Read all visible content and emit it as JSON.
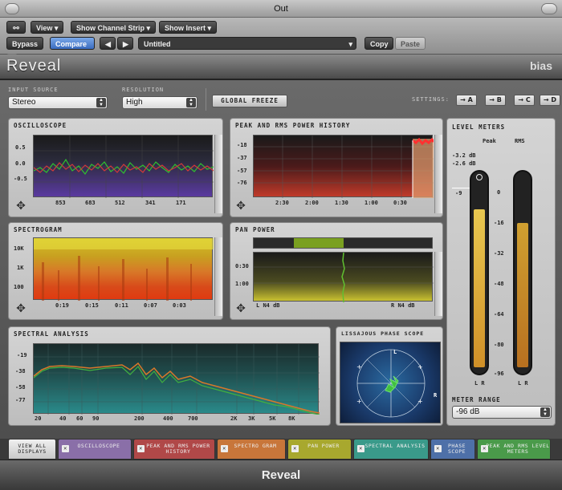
{
  "window": {
    "title": "Out"
  },
  "toolbar": {
    "view_label": "View",
    "show_channel_strip_label": "Show Channel Strip",
    "show_insert_label": "Show Insert",
    "bypass_label": "Bypass",
    "compare_label": "Compare",
    "preset_name": "Untitled",
    "copy_label": "Copy",
    "paste_label": "Paste"
  },
  "brand": {
    "name": "Reveal",
    "logo": "bias"
  },
  "controls": {
    "input_source_label": "Input Source",
    "input_source_value": "Stereo",
    "resolution_label": "Resolution",
    "resolution_value": "High",
    "global_freeze_label": "Global Freeze",
    "settings_label": "Settings:",
    "settings_slots": [
      "A",
      "B",
      "C",
      "D"
    ]
  },
  "oscilloscope": {
    "title": "Oscilloscope",
    "y_ticks": [
      "0.5",
      "0.0",
      "-0.5"
    ],
    "x_ticks": [
      "853",
      "683",
      "512",
      "341",
      "171"
    ]
  },
  "peak_rms_history": {
    "title": "Peak and RMS Power History",
    "y_ticks": [
      "-18",
      "-37",
      "-57",
      "-76"
    ],
    "x_ticks": [
      "2:30",
      "2:00",
      "1:30",
      "1:00",
      "0:30"
    ]
  },
  "spectrogram": {
    "title": "Spectrogram",
    "y_ticks": [
      "10K",
      "1K",
      "100"
    ],
    "x_ticks": [
      "0:19",
      "0:15",
      "0:11",
      "0:07",
      "0:03"
    ]
  },
  "pan_power": {
    "title": "Pan Power",
    "y_ticks": [
      "0:30",
      "1:00"
    ],
    "left_label": "L",
    "left_value": "N4 dB",
    "right_label": "R",
    "right_value": "N4 dB"
  },
  "spectral_analysis": {
    "title": "Spectral Analysis",
    "y_ticks": [
      "-19",
      "-38",
      "-58",
      "-77"
    ],
    "x_ticks": [
      "20",
      "40",
      "60",
      "90",
      "200",
      "400",
      "700",
      "2K",
      "3K",
      "5K",
      "8K"
    ]
  },
  "lissajous": {
    "title": "Lissajous Phase Scope",
    "l_label": "L",
    "r_label": "R"
  },
  "level_meters": {
    "title": "Level Meters",
    "peak_label": "Peak",
    "rms_label": "RMS",
    "peak_value": "-3.2 dB",
    "rms_value": "-2.6 dB",
    "marker_value": "-9",
    "scale": [
      "0",
      "-16",
      "-32",
      "-48",
      "-64",
      "-80",
      "-96"
    ],
    "lr_label": "L R",
    "range_label": "Meter Range",
    "range_value": "-96 dB",
    "peak_level_fraction": 0.82,
    "rms_level_fraction": 0.75
  },
  "tabs": [
    {
      "label": "View All Displays",
      "color": "#5a5a5a"
    },
    {
      "label": "Oscilloscope",
      "color": "#8a6fa8"
    },
    {
      "label": "Peak and RMS Power History",
      "color": "#b04848"
    },
    {
      "label": "Spectro gram",
      "color": "#c8763a"
    },
    {
      "label": "Pan Power",
      "color": "#a8a82e"
    },
    {
      "label": "Spectral Analysis",
      "color": "#3a9a8a"
    },
    {
      "label": "Phase Scope",
      "color": "#4e70a8"
    },
    {
      "label": "Peak and RMS Level Meters",
      "color": "#4a9a4a"
    }
  ],
  "footer": {
    "title": "Reveal"
  }
}
